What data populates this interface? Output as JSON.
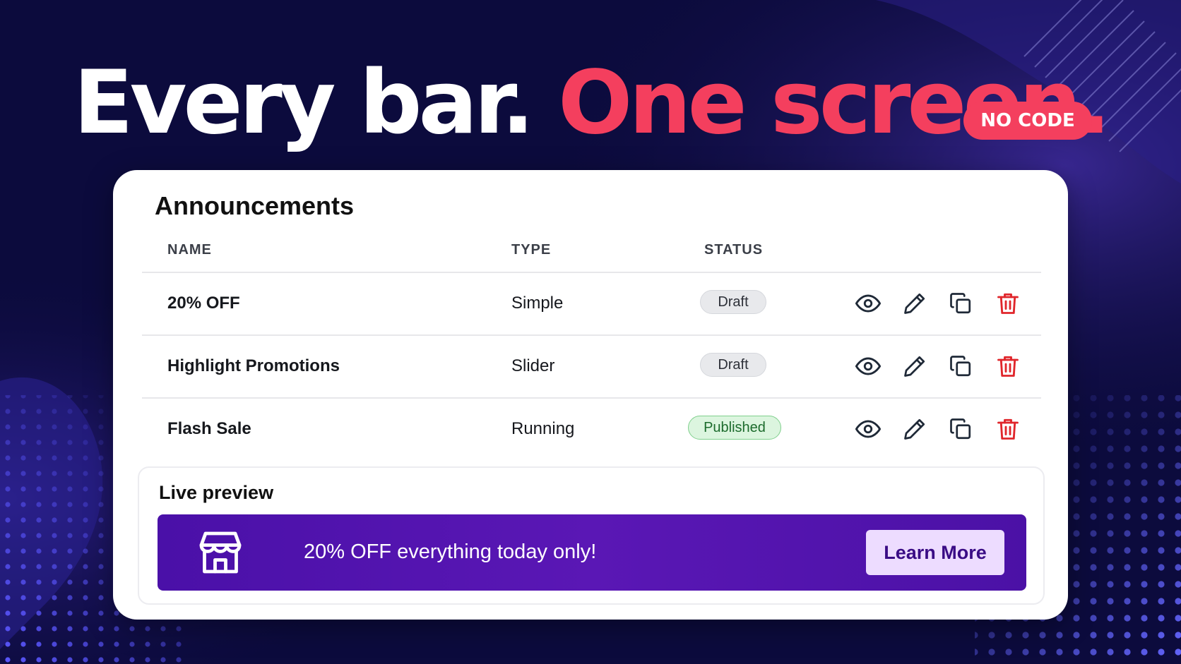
{
  "hero": {
    "headline_white": "Every bar.",
    "headline_accent": "One screen.",
    "badge": "NO CODE"
  },
  "card": {
    "title": "Announcements",
    "columns": {
      "name": "NAME",
      "type": "TYPE",
      "status": "STATUS"
    },
    "rows": [
      {
        "name": "20% OFF",
        "type": "Simple",
        "status": "Draft"
      },
      {
        "name": "Highlight Promotions",
        "type": "Slider",
        "status": "Draft"
      },
      {
        "name": "Flash Sale",
        "type": "Running",
        "status": "Published"
      }
    ],
    "row_actions": [
      "eye-icon",
      "pencil-icon",
      "copy-icon",
      "trash-icon"
    ]
  },
  "preview": {
    "title": "Live preview",
    "bar_text": "20% OFF everything today only!",
    "cta_label": "Learn More",
    "icon": "storefront-icon"
  },
  "colors": {
    "background": "#0c0b3d",
    "accent": "#f43f5e",
    "promo_bar": "#5a17b5",
    "cta_background": "#eddcff",
    "delete": "#e0262b",
    "published_bg": "#dcf5df",
    "draft_bg": "#e8e9ec"
  }
}
